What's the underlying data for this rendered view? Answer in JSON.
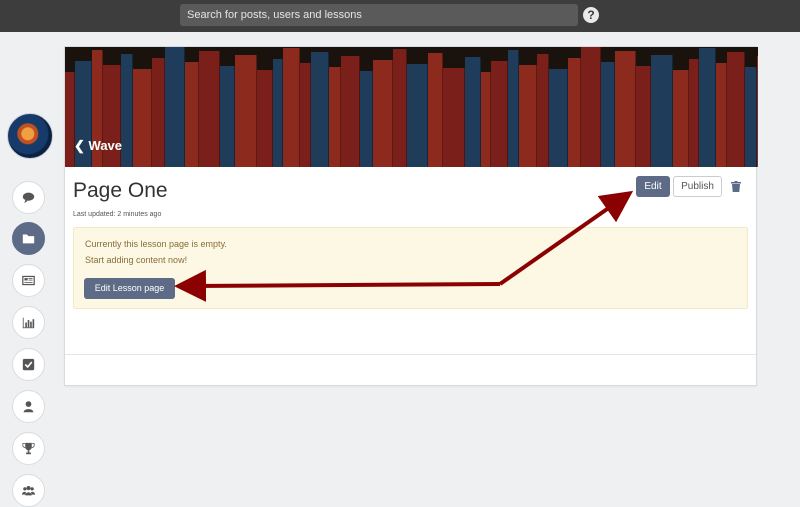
{
  "topbar": {
    "search_placeholder": "Search for posts, users and lessons",
    "help_glyph": "?"
  },
  "sidebar": {
    "items": [
      {
        "icon": "chat-icon",
        "active": false
      },
      {
        "icon": "folder-icon",
        "active": true
      },
      {
        "icon": "newspaper-icon",
        "active": false
      },
      {
        "icon": "bar-chart-icon",
        "active": false
      },
      {
        "icon": "checkbox-icon",
        "active": false
      },
      {
        "icon": "user-icon",
        "active": false
      },
      {
        "icon": "trophy-icon",
        "active": false
      },
      {
        "icon": "group-icon",
        "active": false
      }
    ]
  },
  "lesson": {
    "back_label": "Wave",
    "title": "Page One",
    "last_updated": "Last updated: 2 minutes ago",
    "edit_label": "Edit",
    "publish_label": "Publish",
    "notice_line1": "Currently this lesson page is empty.",
    "notice_line2": "Start adding content now!",
    "edit_lesson_label": "Edit Lesson page"
  },
  "colors": {
    "topbar": "#3d3d3d",
    "accent": "#5d6b87",
    "notice_bg": "#fcf8e3",
    "notice_text": "#8a6d3b",
    "annotation_arrow": "#8b0000"
  }
}
